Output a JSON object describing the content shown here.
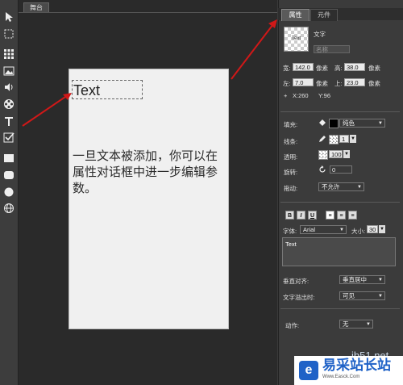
{
  "toolbar": {
    "tools": [
      "select-arrow-icon",
      "crop-select-icon",
      "grid-icon",
      "image-icon",
      "audio-icon",
      "video-reel-icon",
      "text-tool-icon",
      "checkbox-icon",
      "rectangle-icon",
      "rounded-rect-icon",
      "circle-icon",
      "globe-icon"
    ]
  },
  "stage": {
    "tab_label": "舞台",
    "text_element": "Text",
    "body_text": "一旦文本被添加，你可以在属性对话框中进一步编辑参数。"
  },
  "panel": {
    "tabs": [
      "属性",
      "元件"
    ],
    "thumb_label": "Text",
    "type_label": "文字",
    "name_placeholder": "名称",
    "width_label": "宽:",
    "width_value": "142.0",
    "height_label": "高:",
    "height_value": "38.0",
    "unit": "像素",
    "left_label": "左:",
    "left_value": "7.0",
    "top_label": "上:",
    "top_value": "23.0",
    "coord_plus": "+",
    "coord_x": "X:260",
    "coord_y": "Y:96",
    "fill_label": "填充:",
    "fill_value": "纯色",
    "stroke_label": "线条:",
    "stroke_value": "1",
    "opacity_label": "透明:",
    "opacity_value": "100",
    "rotate_label": "旋转:",
    "rotate_value": "0",
    "drag_label": "拖动:",
    "drag_value": "不允许",
    "bold": "B",
    "italic": "I",
    "underline": "U",
    "font_label": "字体:",
    "font_value": "Arial",
    "size_label": "大小:",
    "size_value": "30",
    "text_content": "Text",
    "valign_label": "垂直对齐:",
    "valign_value": "垂直居中",
    "overflow_label": "文字溢出时:",
    "overflow_value": "可见",
    "action_label": "动作:",
    "action_value": "无"
  },
  "watermark": {
    "logo_char": "e",
    "title": "易采站长站",
    "url": "Www.Easck.Com",
    "jb": "jb51.net"
  },
  "colors": {
    "accent_arrow": "#d01818",
    "brand_blue": "#1f62c7"
  }
}
